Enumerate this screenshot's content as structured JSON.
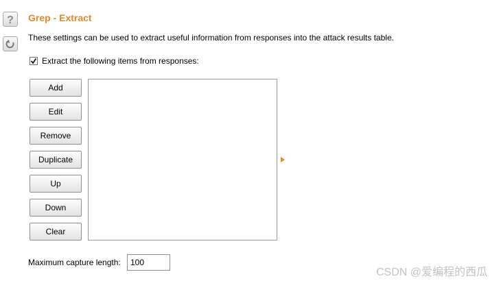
{
  "section": {
    "title": "Grep - Extract",
    "description": "These settings can be used to extract useful information from responses into the attack results table."
  },
  "side_icons": {
    "help": "help-icon",
    "reset": "reset-icon"
  },
  "extract_checkbox": {
    "label": "Extract the following items from responses:",
    "checked": true
  },
  "buttons": {
    "add": "Add",
    "edit": "Edit",
    "remove": "Remove",
    "duplicate": "Duplicate",
    "up": "Up",
    "down": "Down",
    "clear": "Clear"
  },
  "items_list": [],
  "max_capture": {
    "label": "Maximum capture length:",
    "value": "100"
  },
  "watermark": "CSDN @爱编程的西瓜",
  "colors": {
    "accent": "#e8882a"
  }
}
